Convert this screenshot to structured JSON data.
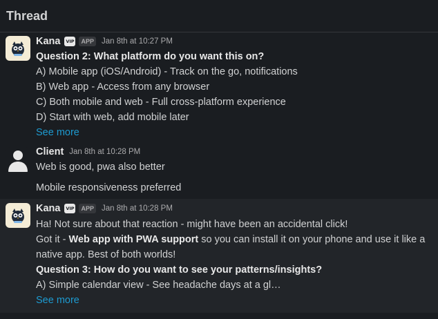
{
  "header": {
    "title": "Thread"
  },
  "badges": {
    "vip": "VIP",
    "app": "APP"
  },
  "messages": [
    {
      "author": "Kana",
      "time": "Jan 8th at 10:27 PM",
      "lines": [
        "Question 2: What platform do you want this on?",
        "A) Mobile app (iOS/Android) - Track on the go, notifications",
        "B) Web app - Access from any browser",
        "C) Both mobile and web - Full cross-platform experience",
        "D) Start with web, add mobile later"
      ],
      "see_more": "See more"
    },
    {
      "author": "Client",
      "time": "Jan 8th at 10:28 PM",
      "lines": [
        "Web is good, pwa also better",
        "Mobile responsiveness preferred"
      ]
    },
    {
      "author": "Kana",
      "time": "Jan 8th at 10:28 PM",
      "lines": [
        "Ha! Not sure about that reaction - might have been an accidental click!",
        "Got it - ",
        "Web app with PWA support",
        " so you can install it on your phone and use it like a",
        "native app. Best of both worlds!",
        "Question 3: How do you want to see your patterns/insights?",
        "A) Simple calendar view - See headache days at a gl…"
      ],
      "see_more": "See more"
    }
  ],
  "colors": {
    "background": "#1a1d21",
    "link": "#1d9bd1",
    "text": "#d1d2d3"
  }
}
